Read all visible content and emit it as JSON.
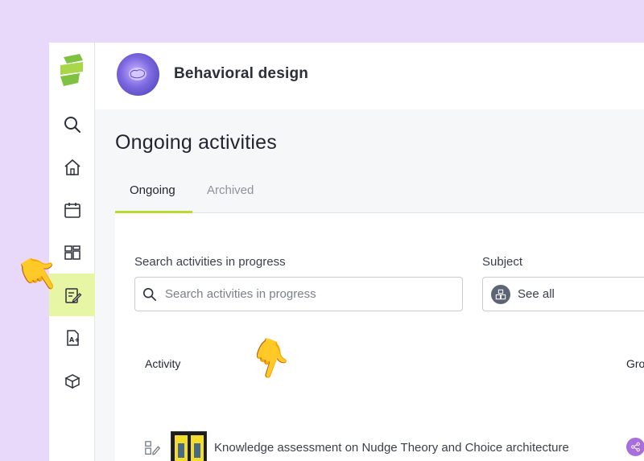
{
  "header": {
    "title": "Behavioral design"
  },
  "page": {
    "title": "Ongoing activities"
  },
  "tabs": [
    {
      "label": "Ongoing",
      "active": true
    },
    {
      "label": "Archived",
      "active": false
    }
  ],
  "search": {
    "label": "Search activities in progress",
    "placeholder": "Search activities in progress"
  },
  "subject": {
    "label": "Subject",
    "value": "See all"
  },
  "table": {
    "columns": [
      "Activity",
      "Gro"
    ],
    "rows": [
      {
        "title": "Knowledge assessment on Nudge Theory and Choice architecture"
      }
    ]
  },
  "colors": {
    "accent": "#b8db2e",
    "active_nav_bg": "#e7f6a4",
    "page_bg": "#e8d9fa",
    "group_badge": "#a86fdc"
  },
  "icons": [
    "logo-icon",
    "search-icon",
    "home-icon",
    "calendar-icon",
    "dashboard-icon",
    "activities-icon",
    "grades-icon",
    "box-icon",
    "magnifier-icon",
    "subject-icon",
    "quiz-icon",
    "share-icon",
    "pointing-hand-icon"
  ]
}
